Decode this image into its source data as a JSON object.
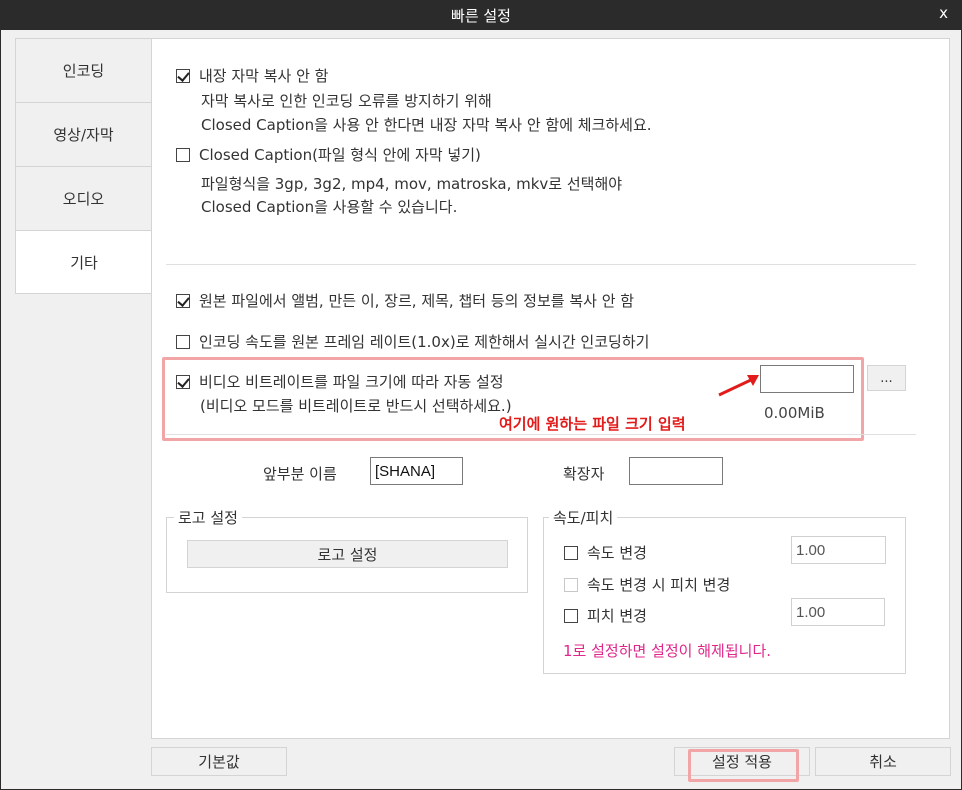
{
  "window": {
    "title": "빠른 설정",
    "close_label": "x"
  },
  "sidebar": {
    "items": [
      {
        "label": "인코딩"
      },
      {
        "label": "영상/자막"
      },
      {
        "label": "오디오"
      },
      {
        "label": "기타"
      }
    ]
  },
  "options": {
    "no_copy_subtitle": {
      "label": "내장 자막 복사 안 함",
      "checked": true,
      "desc1": "자막 복사로 인한 인코딩 오류를 방지하기 위해",
      "desc2": "Closed Caption을 사용 안 한다면 내장 자막 복사 안 함에 체크하세요."
    },
    "closed_caption": {
      "label": "Closed Caption(파일 형식 안에 자막 넣기)",
      "checked": false,
      "desc1": "파일형식을 3gp, 3g2, mp4, mov, matroska, mkv로 선택해야",
      "desc2": "Closed Caption을 사용할 수 있습니다."
    },
    "no_copy_metadata": {
      "label": "원본 파일에서 앨범, 만든 이, 장르, 제목, 챕터 등의 정보를 복사 안 함",
      "checked": true
    },
    "realtime": {
      "label": "인코딩 속도를 원본 프레임 레이트(1.0x)로 제한해서 실시간 인코딩하기",
      "checked": false
    },
    "auto_bitrate": {
      "label": "비디오 비트레이트를 파일 크기에 따라 자동 설정",
      "checked": true,
      "desc": "(비디오 모드를 비트레이트로 반드시 선택하세요.)",
      "filesize_value": "",
      "browse_label": "...",
      "size_readout": "0.00MiB"
    }
  },
  "annotation": {
    "text": "여기에 원하는 파일 크기 입력",
    "color": "#e21b1b"
  },
  "prefix": {
    "label": "앞부분 이름",
    "value": "[SHANA]"
  },
  "extension": {
    "label": "확장자",
    "value": ""
  },
  "logo_group": {
    "title": "로고 설정",
    "button_label": "로고 설정"
  },
  "speed_group": {
    "title": "속도/피치",
    "speed_change": {
      "label": "속도 변경",
      "checked": false,
      "value": "1.00"
    },
    "pitch_with_speed": {
      "label": "속도 변경 시 피치 변경",
      "checked": false,
      "disabled": true
    },
    "pitch_change": {
      "label": "피치 변경",
      "checked": false,
      "value": "1.00"
    },
    "note": "1로 설정하면 설정이 해제됩니다.",
    "note_color": "#e0278b"
  },
  "footer": {
    "default_label": "기본값",
    "apply_label": "설정 적용",
    "cancel_label": "취소"
  },
  "colors": {
    "highlight": "#f2a5a7",
    "titlebar": "#2b2b2b"
  }
}
